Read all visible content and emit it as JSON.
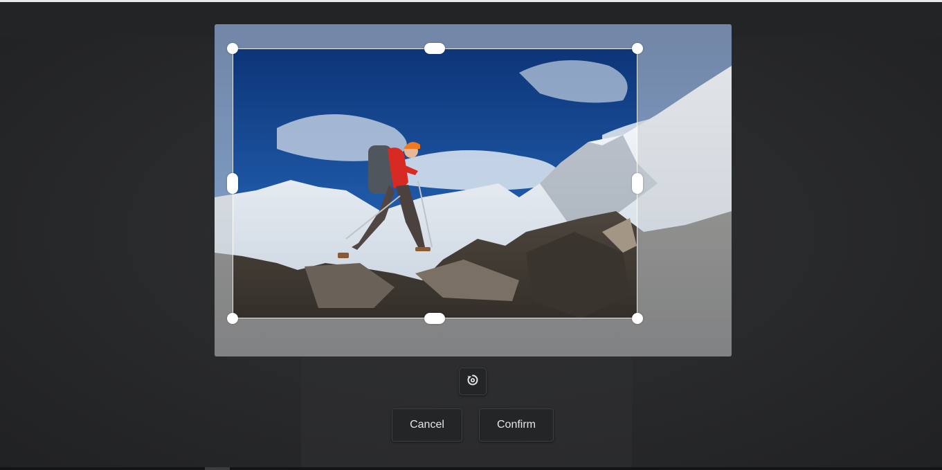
{
  "icons": {
    "reset": "rotate-reset-icon"
  },
  "buttons": {
    "cancel_label": "Cancel",
    "confirm_label": "Confirm"
  },
  "colors": {
    "sky": "#0f3e86",
    "rock": "#3b3630",
    "jacket": "#d62a23",
    "hat": "#f07a1f"
  }
}
